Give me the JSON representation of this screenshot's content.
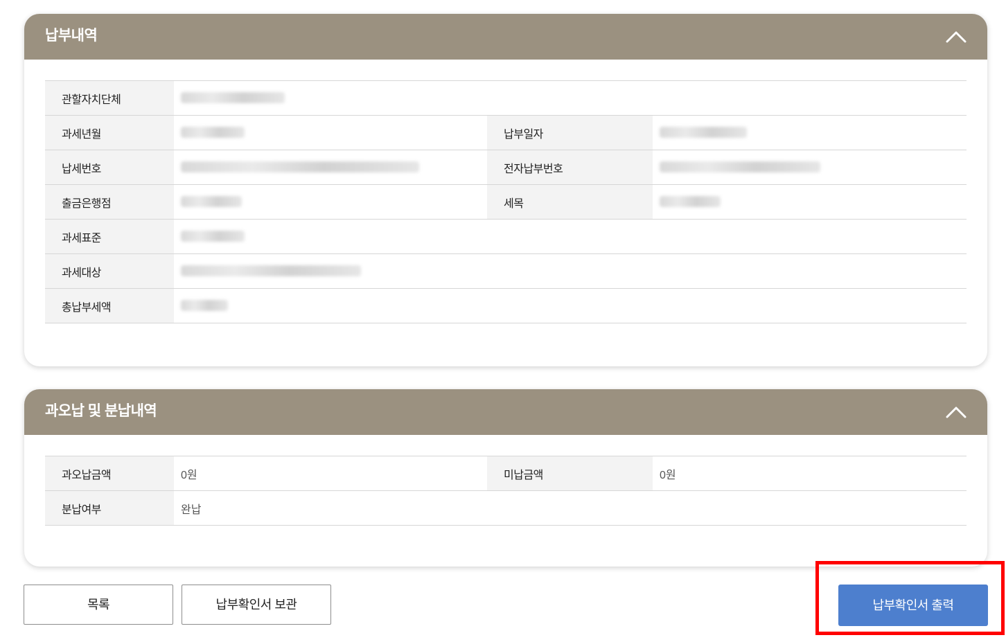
{
  "payment_section": {
    "title": "납부내역",
    "rows": [
      {
        "label": "관할자치단체"
      },
      {
        "label": "과세년월",
        "label2": "납부일자"
      },
      {
        "label": "납세번호",
        "label2": "전자납부번호"
      },
      {
        "label": "출금은행점",
        "label2": "세목"
      },
      {
        "label": "과세표준"
      },
      {
        "label": "과세대상"
      },
      {
        "label": "총납부세액"
      }
    ]
  },
  "overpayment_section": {
    "title": "과오납 및 분납내역",
    "rows": [
      {
        "label": "과오납금액",
        "value": "0원",
        "label2": "미납금액",
        "value2": "0원"
      },
      {
        "label": "분납여부",
        "value": "완납"
      }
    ]
  },
  "buttons": {
    "list": "목록",
    "save": "납부확인서 보관",
    "print": "납부확인서 출력"
  },
  "colors": {
    "header": "#9b9180",
    "primary": "#4d7fce",
    "highlight": "#ff0000"
  }
}
